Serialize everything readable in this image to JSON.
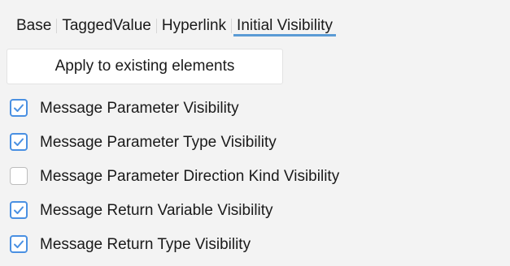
{
  "tabs": [
    {
      "label": "Base",
      "active": false
    },
    {
      "label": "TaggedValue",
      "active": false
    },
    {
      "label": "Hyperlink",
      "active": false
    },
    {
      "label": "Initial Visibility",
      "active": true
    }
  ],
  "apply_button_label": "Apply to existing elements",
  "options": [
    {
      "label": "Message Parameter Visibility",
      "checked": true
    },
    {
      "label": "Message Parameter Type Visibility",
      "checked": true
    },
    {
      "label": "Message Parameter Direction Kind Visibility",
      "checked": false
    },
    {
      "label": "Message Return Variable Visibility",
      "checked": true
    },
    {
      "label": "Message Return Type Visibility",
      "checked": true
    }
  ],
  "colors": {
    "accent": "#5b9bd5",
    "checkbox_border": "#4a90e2",
    "background": "#f3f3f3"
  },
  "icons": {
    "checkbox_checked": "checkmark-icon"
  }
}
